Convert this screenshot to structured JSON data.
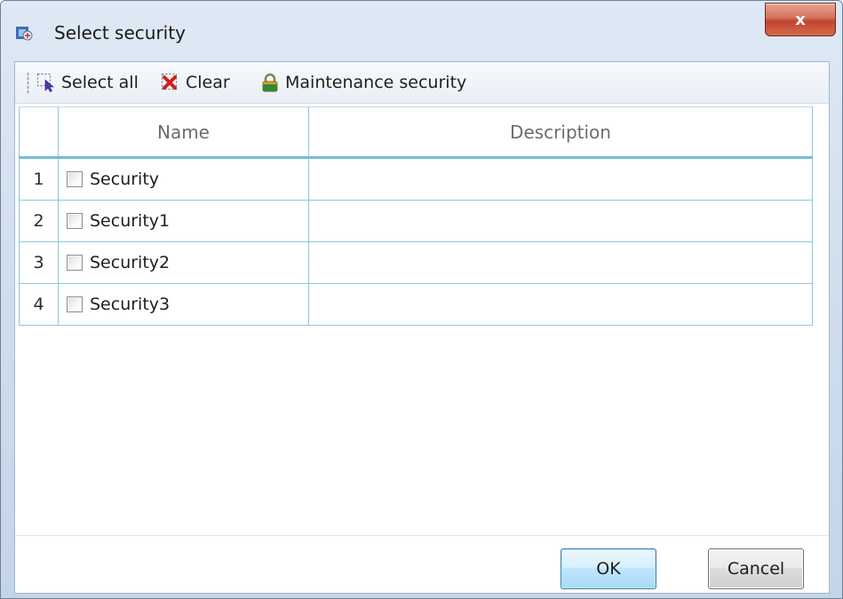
{
  "window": {
    "title": "Select security",
    "close_glyph": "x"
  },
  "toolbar": {
    "select_all": "Select all",
    "clear": "Clear",
    "maintenance": "Maintenance security"
  },
  "grid": {
    "columns": [
      "Name",
      "Description"
    ],
    "rows": [
      {
        "num": "1",
        "name": "Security",
        "description": ""
      },
      {
        "num": "2",
        "name": "Security1",
        "description": ""
      },
      {
        "num": "3",
        "name": "Security2",
        "description": ""
      },
      {
        "num": "4",
        "name": "Security3",
        "description": ""
      }
    ]
  },
  "footer": {
    "ok": "OK",
    "cancel": "Cancel"
  },
  "icons": {
    "title": "security-app-icon",
    "select_all": "select-all-icon",
    "clear": "clear-icon",
    "maintenance": "lock-icon"
  },
  "colors": {
    "grid_line": "#8fc6de",
    "header_underline": "#75bcd6",
    "close_button": "#c0442c"
  }
}
